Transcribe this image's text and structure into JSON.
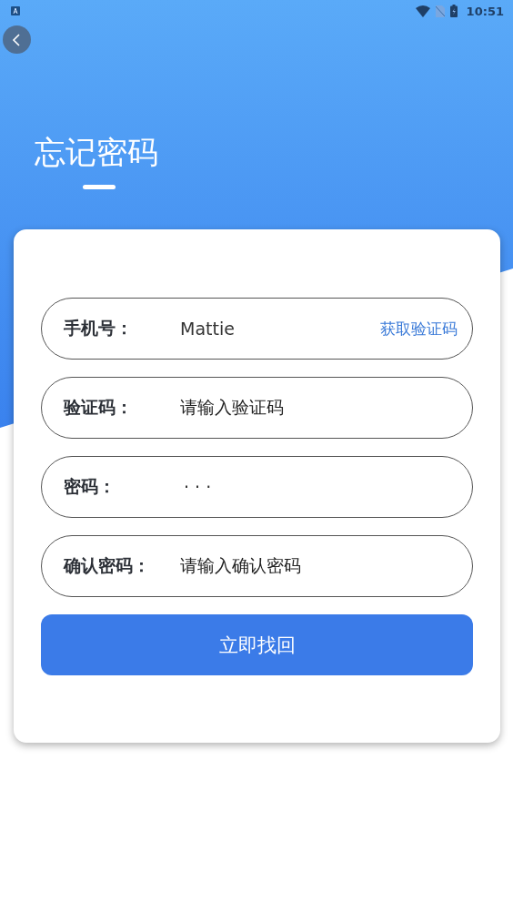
{
  "status_bar": {
    "time": "10:51"
  },
  "title": "忘记密码",
  "form": {
    "fields": [
      {
        "label": "手机号：",
        "kind": "text",
        "value": "Mattie",
        "action": "获取验证码"
      },
      {
        "label": "验证码：",
        "kind": "text",
        "placeholder": "请输入验证码"
      },
      {
        "label": "密码：",
        "kind": "password",
        "value": "· · ·"
      },
      {
        "label": "确认密码：",
        "kind": "text",
        "placeholder": "请输入确认密码"
      }
    ],
    "submit": "立即找回"
  }
}
